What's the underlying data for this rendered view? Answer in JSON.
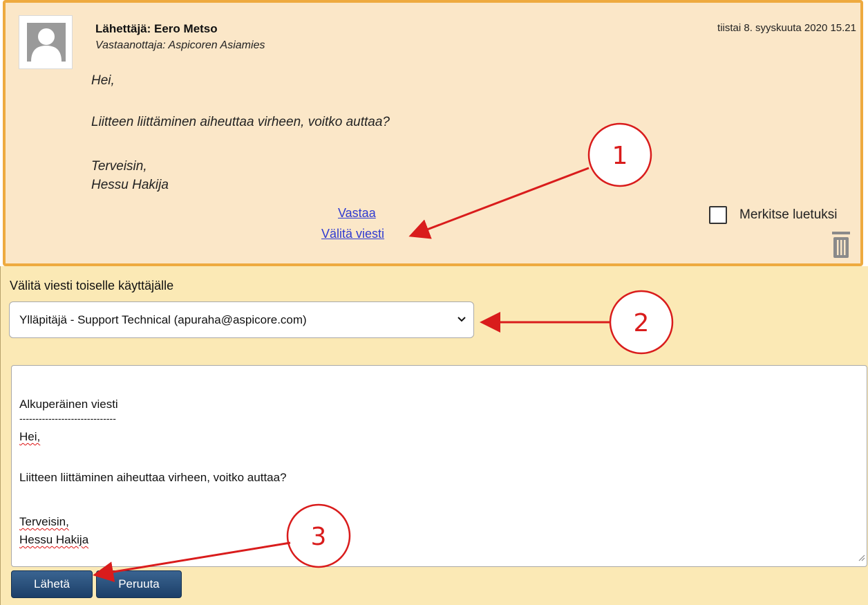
{
  "message": {
    "sender": "Lähettäjä: Eero Metso",
    "recipient": "Vastaanottaja: Aspicoren Asiamies",
    "date": "tiistai 8. syyskuuta 2020 15.21",
    "body": [
      "Hei,",
      "Liitteen liittäminen aiheuttaa virheen, voitko auttaa?",
      "Terveisin,",
      "Hessu Hakija"
    ],
    "reply_link": "Vastaa",
    "forward_link": "Välitä viesti",
    "mark_read_label": "Merkitse luetuksi",
    "mark_read_checked": false
  },
  "forward": {
    "title": "Välitä viesti toiselle käyttäjälle",
    "recipient_selected": "Ylläpitäjä - Support Technical (apuraha@aspicore.com)",
    "text": {
      "heading": "Alkuperäinen viesti",
      "separator": "------------------------------",
      "greeting": "Hei,",
      "line": "Liitteen liittäminen aiheuttaa virheen, voitko auttaa?",
      "closing": "Terveisin,",
      "signature": "Hessu Hakija"
    },
    "send_label": "Lähetä",
    "cancel_label": "Peruuta"
  },
  "callouts": [
    "1",
    "2",
    "3"
  ],
  "colors": {
    "card_bg": "#fbe7c8",
    "card_border": "#eeaa3f",
    "panel_bg": "#fbe9b5",
    "link": "#2f3bd1",
    "button": "#1c3f68",
    "annotation": "#d91c1c"
  }
}
